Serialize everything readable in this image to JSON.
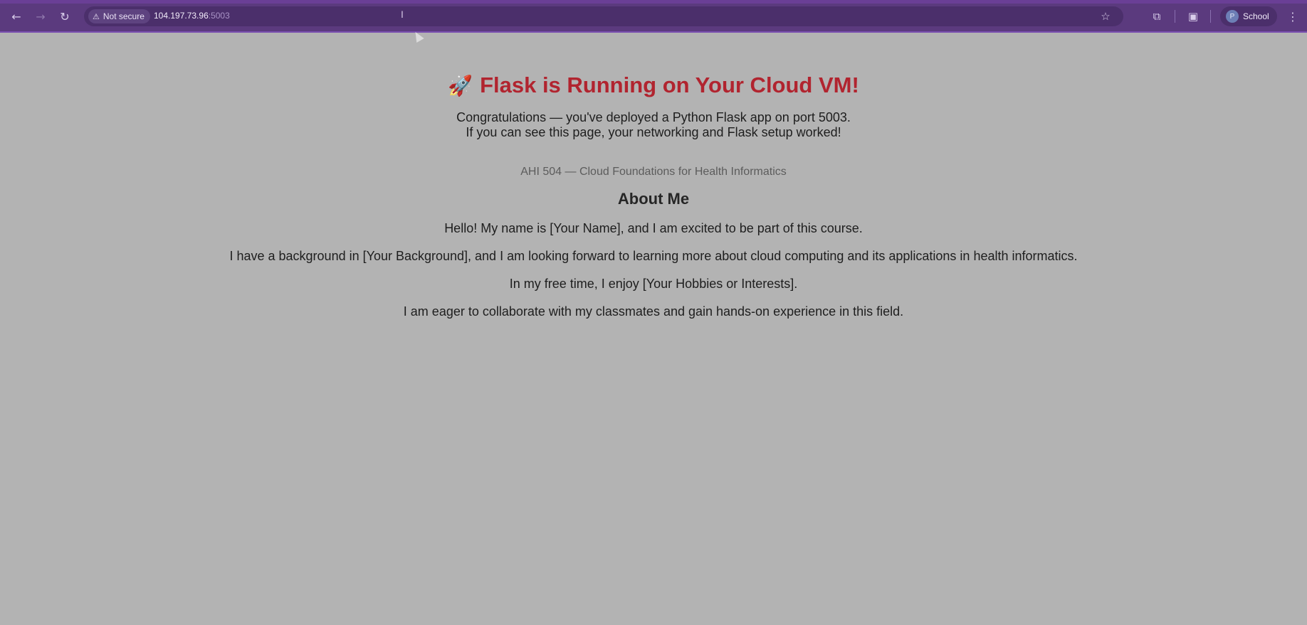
{
  "browser": {
    "security_label": "Not secure",
    "url_host": "104.197.73.96",
    "url_port": ":5003",
    "profile_initial": "P",
    "profile_name": "School",
    "icons": {
      "back": "arrow-left-icon",
      "forward": "arrow-right-icon",
      "reload": "reload-icon",
      "warning": "warning-icon",
      "bookmark": "star-icon",
      "extensions": "puzzle-icon",
      "side_panel": "side-panel-icon",
      "menu": "kebab-menu-icon"
    },
    "colors": {
      "toolbar": "#5b3a7e",
      "omnibox": "#4b2f6b"
    }
  },
  "page": {
    "title_emoji": "🚀",
    "title": "Flask is Running on Your Cloud VM!",
    "intro_line1": "Congratulations — you've deployed a Python Flask app on port 5003.",
    "intro_line2": "If you can see this page, your networking and Flask setup worked!",
    "course": "AHI 504 — Cloud Foundations for Health Informatics",
    "about_heading": "About Me",
    "paragraphs": [
      "Hello! My name is [Your Name], and I am excited to be part of this course.",
      "I have a background in [Your Background], and I am looking forward to learning more about cloud computing and its applications in health informatics.",
      "In my free time, I enjoy [Your Hobbies or Interests].",
      "I am eager to collaborate with my classmates and gain hands-on experience in this field."
    ],
    "colors": {
      "title": "#b1242f",
      "background": "#b3b3b3",
      "course_text": "#5c5c5c"
    }
  }
}
